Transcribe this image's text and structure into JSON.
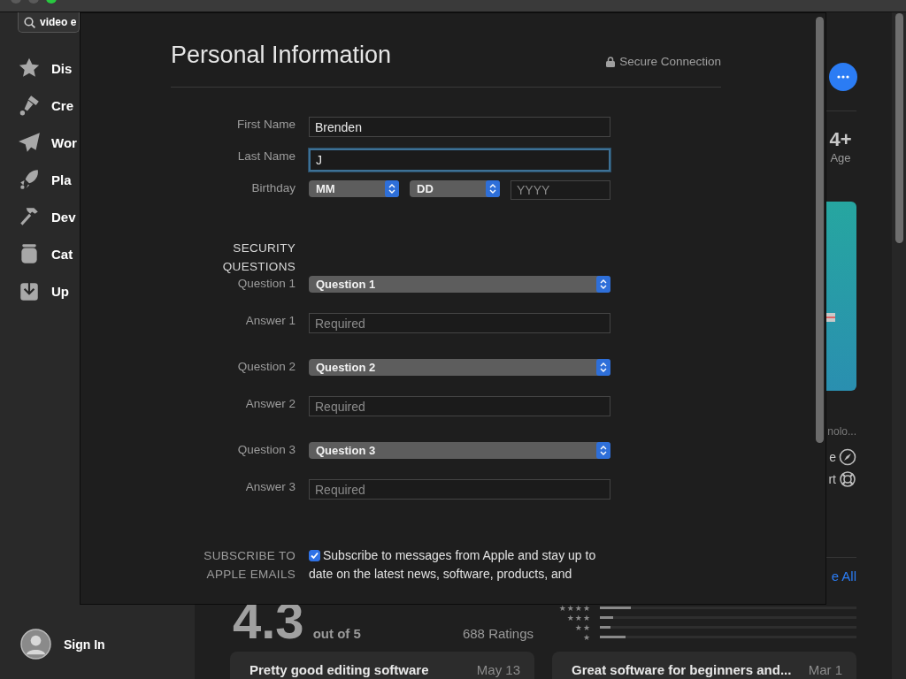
{
  "window": {
    "search": {
      "value": "video e"
    }
  },
  "sidebar": {
    "items": [
      {
        "label": "Dis"
      },
      {
        "label": "Cre"
      },
      {
        "label": "Wor"
      },
      {
        "label": "Pla"
      },
      {
        "label": "Dev"
      },
      {
        "label": "Cat"
      },
      {
        "label": "Up"
      }
    ],
    "account": {
      "label": "Sign In"
    }
  },
  "app": {
    "age": {
      "value": "4+",
      "label": "Age"
    },
    "description_fragment": "nolo...",
    "links": [
      {
        "label": "e"
      },
      {
        "label": "rt"
      }
    ],
    "see_all": "e All",
    "ratings": {
      "average": "4.3",
      "scale": "out of 5",
      "count": "688 Ratings",
      "distribution": [
        {
          "label": "★★★★",
          "level": 0.12
        },
        {
          "label": "★★★",
          "level": 0.05
        },
        {
          "label": "★★",
          "level": 0.04
        },
        {
          "label": "★",
          "level": 0.1
        }
      ]
    },
    "reviews": [
      {
        "title": "Pretty good editing software",
        "date": "May 13"
      },
      {
        "title": "Great software for beginners and...",
        "date": "Mar 1"
      }
    ]
  },
  "sheet": {
    "title": "Personal Information",
    "secure": "Secure Connection",
    "fields": [
      {
        "kind": "text",
        "label": "First Name",
        "value": "Brenden",
        "focused": false
      },
      {
        "kind": "text",
        "label": "Last Name",
        "value": "J",
        "focused": true
      },
      {
        "kind": "date",
        "label": "Birthday",
        "parts": [
          {
            "kind": "select",
            "value": "MM"
          },
          {
            "kind": "select",
            "value": "DD"
          },
          {
            "kind": "text",
            "placeholder": "YYYY"
          }
        ]
      }
    ],
    "security": {
      "heading": "SECURITY QUESTIONS",
      "fields": [
        {
          "kind": "select",
          "label": "Question 1",
          "value": "Question 1"
        },
        {
          "kind": "text",
          "label": "Answer 1",
          "placeholder": "Required"
        },
        {
          "kind": "select",
          "label": "Question 2",
          "value": "Question 2"
        },
        {
          "kind": "text",
          "label": "Answer 2",
          "placeholder": "Required"
        },
        {
          "kind": "select",
          "label": "Question 3",
          "value": "Question 3"
        },
        {
          "kind": "text",
          "label": "Answer 3",
          "placeholder": "Required"
        }
      ]
    },
    "subscribe": {
      "label": "SUBSCRIBE TO APPLE EMAILS",
      "checked": true,
      "text": "Subscribe to messages from Apple and stay up to date on the latest news, software, products, and"
    }
  }
}
